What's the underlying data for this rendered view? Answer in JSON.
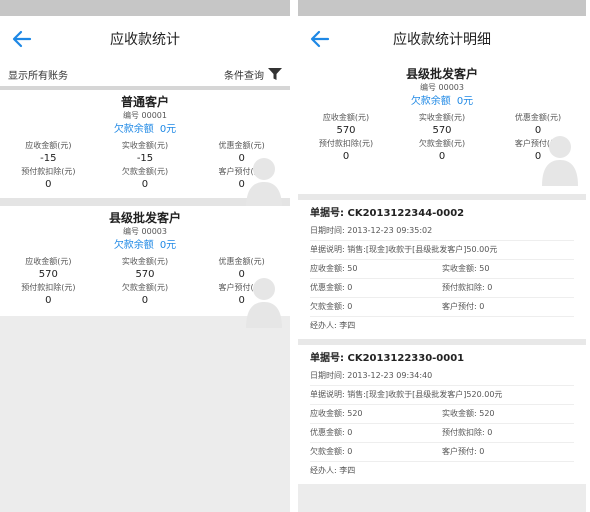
{
  "left": {
    "title": "应收款统计",
    "show_all": "显示所有账务",
    "condition": "条件查询",
    "customers": [
      {
        "name": "普通客户",
        "number": "编号 00001",
        "debt_label": "欠款余额",
        "debt_value": "0元",
        "receivable_label": "应收金额(元)",
        "receivable": "-15",
        "received_label": "实收金额(元)",
        "received": "-15",
        "discount_label": "优惠金额(元)",
        "discount": "0",
        "prepaid_deduct_label": "预付款扣除(元)",
        "prepaid_deduct": "0",
        "owed_label": "欠款金额(元)",
        "owed": "0",
        "prepaid_label": "客户预付(元)",
        "prepaid": "0"
      },
      {
        "name": "县级批发客户",
        "number": "编号 00003",
        "debt_label": "欠款余额",
        "debt_value": "0元",
        "receivable_label": "应收金额(元)",
        "receivable": "570",
        "received_label": "实收金额(元)",
        "received": "570",
        "discount_label": "优惠金额(元)",
        "discount": "0",
        "prepaid_deduct_label": "预付款扣除(元)",
        "prepaid_deduct": "0",
        "owed_label": "欠款金额(元)",
        "owed": "0",
        "prepaid_label": "客户预付(元)",
        "prepaid": "0"
      }
    ]
  },
  "right": {
    "title": "应收款统计明细",
    "customer": {
      "name": "县级批发客户",
      "number": "编号 00003",
      "debt_label": "欠款余额",
      "debt_value": "0元",
      "receivable_label": "应收金额(元)",
      "receivable": "570",
      "received_label": "实收金额(元)",
      "received": "570",
      "discount_label": "优惠金额(元)",
      "discount": "0",
      "prepaid_deduct_label": "预付款扣除(元)",
      "prepaid_deduct": "0",
      "owed_label": "欠款金额(元)",
      "owed": "0",
      "prepaid_label": "客户预付(元)",
      "prepaid": "0"
    },
    "bills": [
      {
        "no": "单据号: CK2013122344-0002",
        "date": "日期时间: 2013-12-23 09:35:02",
        "desc": "单据说明: 销售:[现金]收款于[县级批发客户]50.00元",
        "receivable": "应收金额: 50",
        "received": "实收金额: 50",
        "discount": "优惠金额: 0",
        "prepaid_deduct": "预付款扣除: 0",
        "owed": "欠款金额: 0",
        "prepaid": "客户预付: 0",
        "handler": "经办人: 李四"
      },
      {
        "no": "单据号: CK2013122330-0001",
        "date": "日期时间: 2013-12-23 09:34:40",
        "desc": "单据说明: 销售:[现金]收款于[县级批发客户]520.00元",
        "receivable": "应收金额: 520",
        "received": "实收金额: 520",
        "discount": "优惠金额: 0",
        "prepaid_deduct": "预付款扣除: 0",
        "owed": "欠款金额: 0",
        "prepaid": "客户预付: 0",
        "handler": "经办人: 李四"
      }
    ]
  },
  "icons": {
    "back": "back-arrow-icon",
    "filter": "filter-funnel-icon",
    "avatar": "person-silhouette-icon"
  },
  "colors": {
    "accent": "#1e88e5",
    "statusbar": "#c6c6c6",
    "background": "#ececec"
  }
}
